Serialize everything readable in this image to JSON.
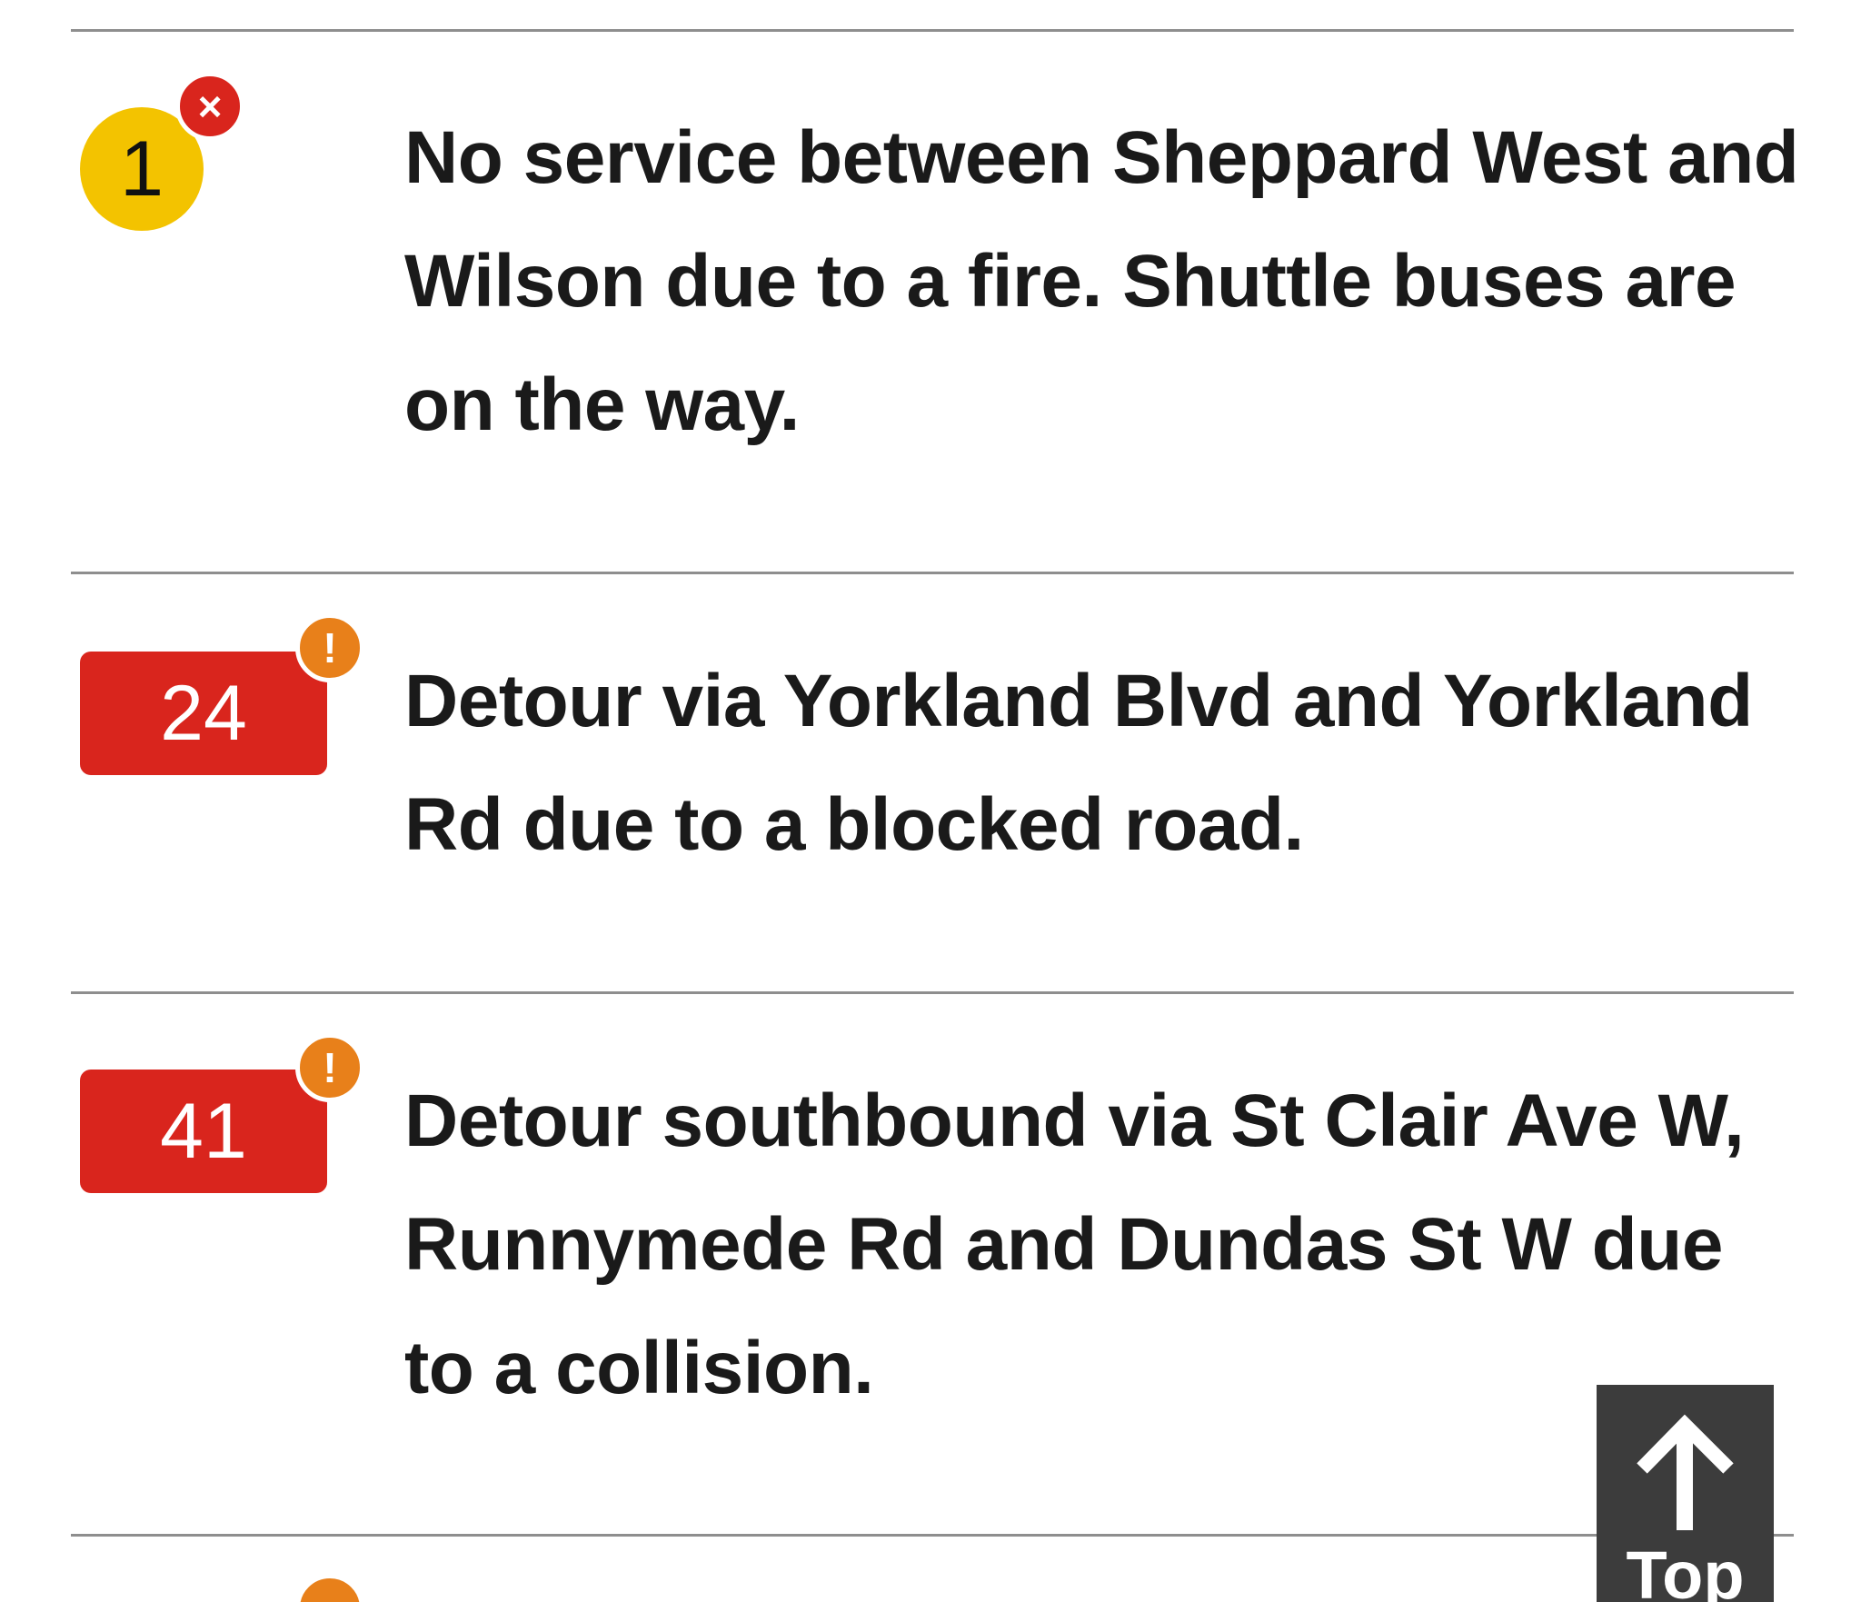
{
  "alerts": [
    {
      "route": "1",
      "route_shape": "circle",
      "route_color": "#f3c300",
      "status_icon": "close-icon",
      "status_symbol": "×",
      "status_color": "#d9251d",
      "message": "No service between Sheppard West and Wilson due to a fire. Shuttle buses are on the way."
    },
    {
      "route": "24",
      "route_shape": "rectangle",
      "route_color": "#d9251d",
      "status_icon": "exclamation-icon",
      "status_symbol": "!",
      "status_color": "#e8801a",
      "message": "Detour via Yorkland Blvd and Yorkland Rd due to a blocked road."
    },
    {
      "route": "41",
      "route_shape": "rectangle",
      "route_color": "#d9251d",
      "status_icon": "exclamation-icon",
      "status_symbol": "!",
      "status_color": "#e8801a",
      "message": "Detour southbound via St Clair Ave W, Runnymede Rd and Dundas St W due to a collision."
    },
    {
      "status_icon": "exclamation-icon",
      "status_color": "#e8801a"
    }
  ],
  "top_button": {
    "label": "Top",
    "icon": "arrow-up-icon"
  }
}
